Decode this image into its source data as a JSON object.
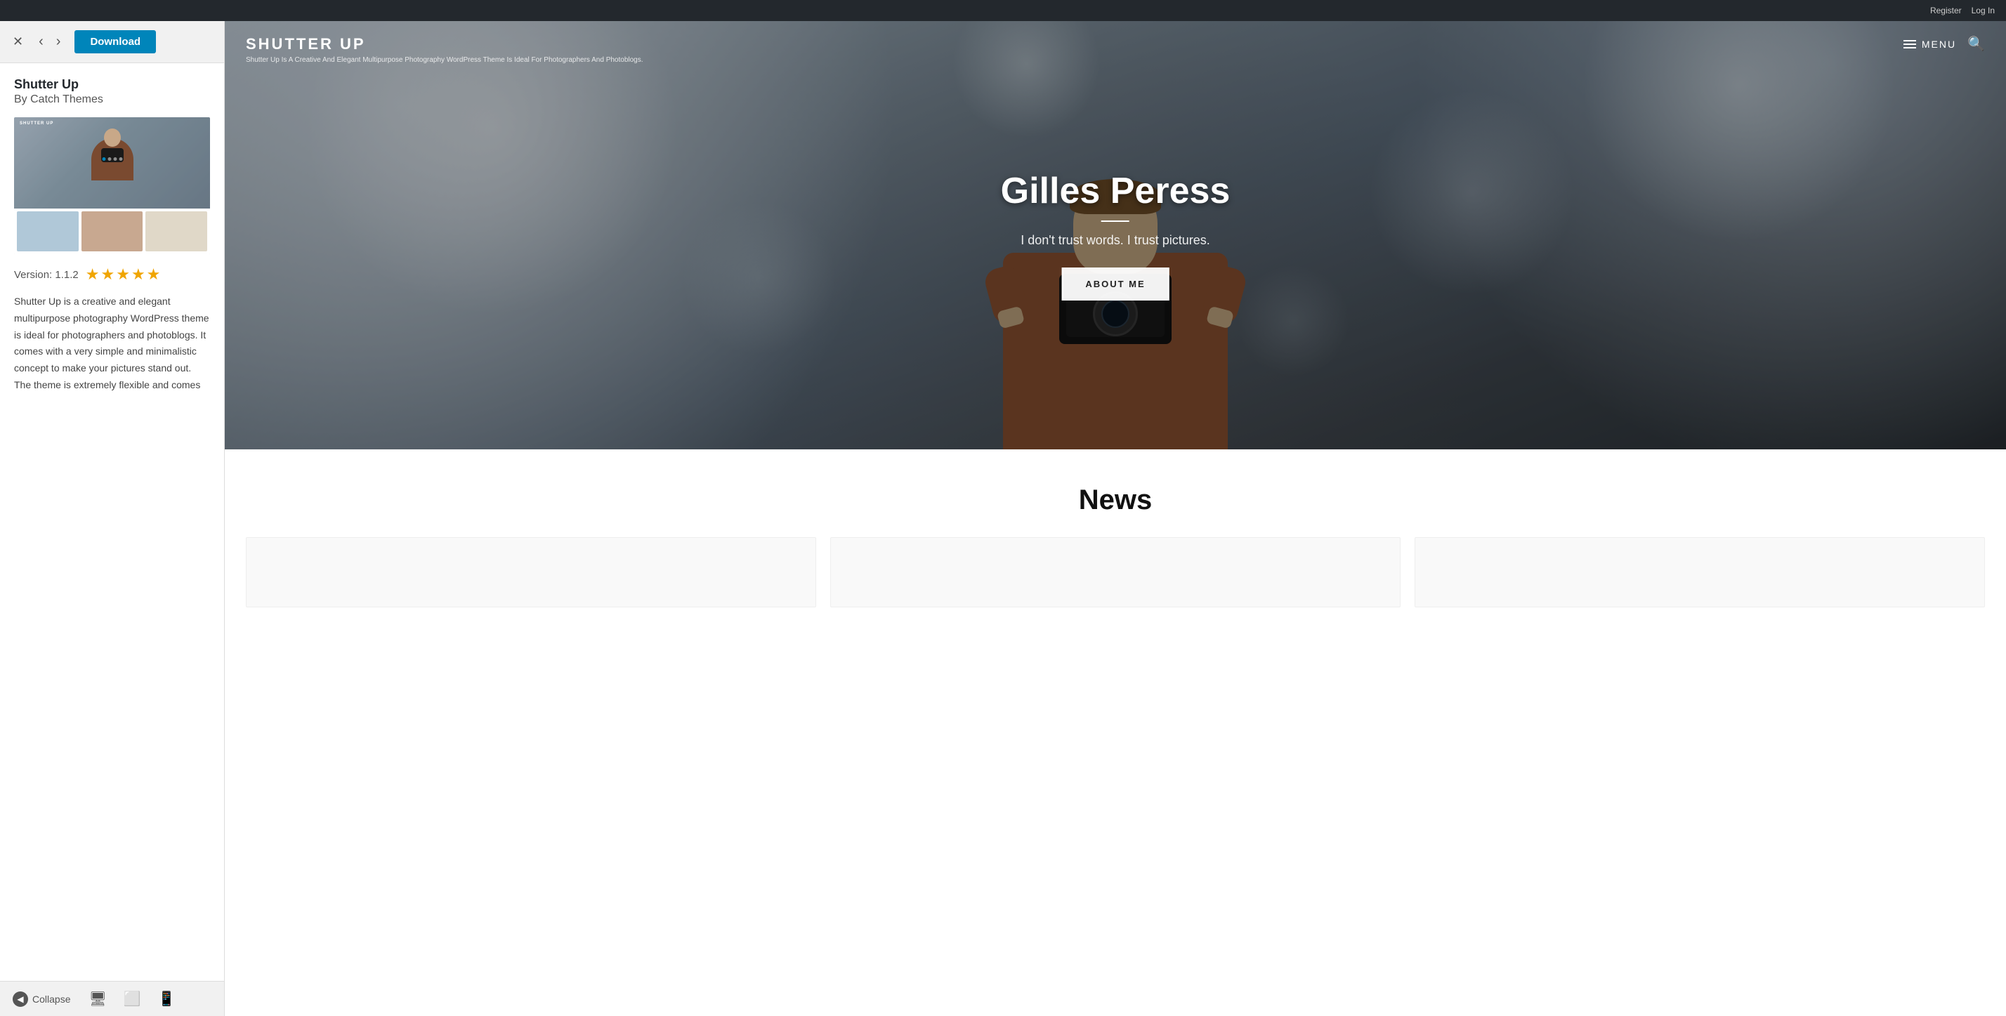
{
  "topbar": {
    "register_label": "Register",
    "login_label": "Log In"
  },
  "sidebar": {
    "close_icon": "✕",
    "back_icon": "‹",
    "forward_icon": "›",
    "download_label": "Download",
    "theme_name": "Shutter Up",
    "theme_author": "By Catch Themes",
    "version_label": "Version: 1.1.2",
    "stars": [
      "★",
      "★",
      "★",
      "★",
      "★"
    ],
    "description": "Shutter Up is a creative and elegant multipurpose photography WordPress theme is ideal for photographers and photoblogs. It comes with a very simple and minimalistic concept to make your pictures stand out. The theme is extremely flexible and comes",
    "collapse_label": "Collapse",
    "preview_dots": [
      1,
      2,
      3,
      4,
      5
    ]
  },
  "site": {
    "logo_name": "SHUTTER UP",
    "logo_tagline": "Shutter Up Is A Creative And Elegant Multipurpose Photography WordPress Theme Is Ideal For Photographers And Photoblogs.",
    "menu_label": "MENU",
    "hero_name": "Gilles Peress",
    "hero_quote": "I don't trust words. I trust pictures.",
    "hero_cta": "ABOUT ME",
    "news_title": "News"
  },
  "colors": {
    "download_btn": "#0085ba",
    "star_color": "#f0a500",
    "top_bar_bg": "#23282d",
    "hero_overlay": "rgba(0,0,0,0.45)"
  }
}
